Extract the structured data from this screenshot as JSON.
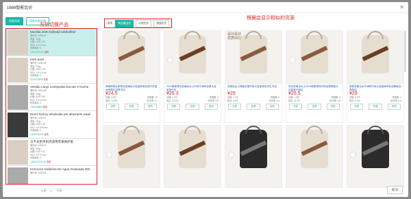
{
  "modal": {
    "title": "1688智能比价",
    "close_icon": "close-icon"
  },
  "annotations": {
    "left": "左侧切换产品",
    "right": "根据会显示相似的货源"
  },
  "left": {
    "tabs": [
      {
        "label": "匹配列表",
        "active": true
      },
      {
        "label": "同款本地资源",
        "active": false
      }
    ],
    "items": [
      {
        "name": "Mochila 2020 b@bold svb/boflesf",
        "meta": [
          "海外仓: USD143",
          "重量: 300g",
          "价格: USD 4.79",
          "SKU: 1*1*1*1cm",
          "可用库存: 0"
        ],
        "sku": "10461617(40)",
        "link": "查看",
        "selected": true,
        "thumb": "beige"
      },
      {
        "name": "back pack",
        "meta": [
          "海外仓: USD143",
          "重量: 300g",
          "价格: USD 3.79",
          "SKU: 1*1*1*1cm",
          "可用库存: 0"
        ],
        "sku": "67D5275B98",
        "link": "查看",
        "selected": false,
        "thumb": "beige"
      },
      {
        "name": "Vestido Largo Lentejuelas Escote V Noche",
        "meta": [
          "海外仓: USD143",
          "重量: 300g",
          "价格: USD 2.99",
          "SKU: 1*1*1*1cm",
          "可用库存: 0"
        ],
        "sku": "1053256898",
        "link": "查看",
        "selected": false,
        "thumb": "grey"
      },
      {
        "name": "Direct factory wholesale pet absorbent towel",
        "meta": [
          "海外仓: USD179",
          "重量: 110g",
          "价格: USD 1.16",
          "SKU: 10*10*15cm",
          "可用库存: 0"
        ],
        "sku": "10346730041",
        "link": "查看",
        "selected": false,
        "thumb": "dark"
      },
      {
        "name": "马卡龙色手机壳适用苹果保护套",
        "meta": [
          "海外仓: USD221",
          "重量: 300g",
          "价格: USD 1.11",
          "SKU: 1*1*1*1cm",
          "可用库存: 0"
        ],
        "sku": "1005472295100",
        "link": "查看",
        "selected": false,
        "thumb": "beige"
      },
      {
        "name": "Hornicom Gaiberita De Agua Graduada 360",
        "meta": [
          "海外仓: USD143"
        ],
        "sku": "",
        "link": "",
        "selected": false,
        "thumb": "grey"
      }
    ],
    "pager": [
      "上页",
      "1",
      "下页"
    ]
  },
  "filters": {
    "label": "排序:",
    "options": [
      {
        "label": "商品最适合",
        "active": true
      },
      {
        "label": "价格优先",
        "active": false
      },
      {
        "label": "销量优先",
        "active": false
      }
    ]
  },
  "cards": [
    {
      "title": "商城购物女款背包双肩包大容量两用包旅行防盗休闲简约百搭书包",
      "price": "¥24.5",
      "meta": [
        "月销: 3.6万",
        "同款数: 12",
        "成交: 10.8%",
        "好评率: 4.7"
      ],
      "promo": "",
      "bag": "beige"
    },
    {
      "title": "2019新款背包双肩包女士时尚牛津布百搭大容量旅行包",
      "price": "¥25.3",
      "meta": [
        "月销: 2.1万",
        "同款数: 8",
        "成交: 12.0%",
        "好评率: 4.8"
      ],
      "promo": "",
      "bag": "brown"
    },
    {
      "title": "双肩包女士韩版百搭时尚大容量背包学生书包",
      "price": "¥29",
      "meta": [
        "月销: 1.7万",
        "同款数: 6",
        "成交: 9.6%",
        "好评率: 4.6"
      ],
      "promo": "设计设计\n优质出行",
      "bag": "beige"
    },
    {
      "title": "包包双肩包女士2019新款简约时尚百搭韩版大容量旅行背包",
      "price": "¥25.5",
      "meta": [
        "月销: 1.2万",
        "同款数: 5",
        "成交: 11.3%",
        "好评率: 4.8"
      ],
      "promo": "",
      "bag": "beige"
    },
    {
      "title": "新款双肩包女牛津布时尚大容量休闲包包韩版百搭背包",
      "price": "¥29",
      "meta": [
        "月销: 9.8千",
        "同款数: 4",
        "成交: 8.2%",
        "好评率: 4.5"
      ],
      "promo": "",
      "bag": "brown"
    },
    {
      "title": "",
      "price": "",
      "meta": [],
      "promo": "",
      "bag": "beige"
    },
    {
      "title": "",
      "price": "",
      "meta": [],
      "promo": "",
      "bag": "brown"
    },
    {
      "title": "",
      "price": "",
      "meta": [],
      "promo": "",
      "bag": "black"
    },
    {
      "title": "",
      "price": "",
      "meta": [],
      "promo": "",
      "bag": "beige"
    },
    {
      "title": "",
      "price": "",
      "meta": [],
      "promo": "",
      "bag": "black"
    }
  ],
  "card_buttons": [
    "关联",
    "查看",
    "采购"
  ],
  "footer": {
    "cancel_label": "取消"
  }
}
